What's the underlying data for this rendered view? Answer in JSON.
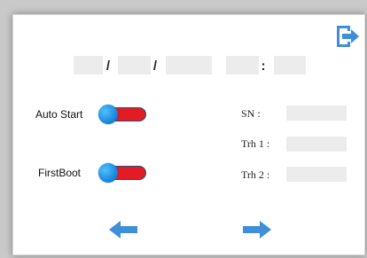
{
  "datetime": {
    "separator_date_1": "/",
    "separator_date_2": "/",
    "separator_time": ":",
    "day_value": "",
    "month_value": "",
    "year_value": "",
    "hour_value": "",
    "minute_value": ""
  },
  "toggles": {
    "auto_start": {
      "label": "Auto Start",
      "track_color": "#e31b23"
    },
    "first_boot": {
      "label": "FirstBoot",
      "track_color": "#e31b23"
    }
  },
  "info": {
    "sn": {
      "label": "SN :",
      "value": ""
    },
    "trh1": {
      "label": "Trh 1 :",
      "value": ""
    },
    "trh2": {
      "label": "Trh 2 :",
      "value": ""
    }
  },
  "icons": {
    "exit": "exit-icon",
    "previous": "arrow-left-icon",
    "next": "arrow-right-icon"
  },
  "colors": {
    "accent": "#3f8fd8",
    "toggle_off": "#e31b23",
    "knob": "#1a8be0"
  }
}
